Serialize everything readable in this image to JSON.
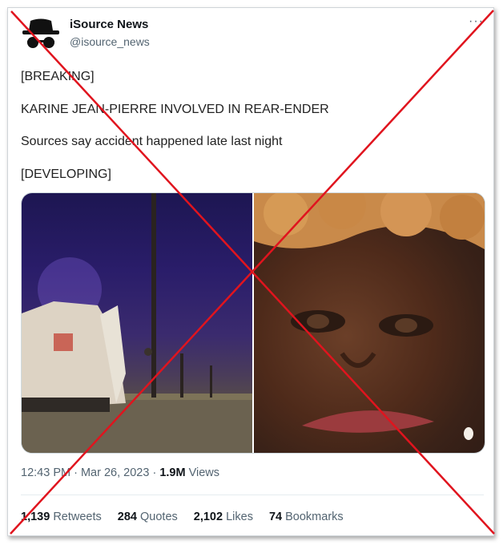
{
  "tweet": {
    "author_name": "iSource News",
    "author_handle": "@isource_news",
    "more_label": "···",
    "lines": [
      "[BREAKING]",
      "KARINE JEAN-PIERRE INVOLVED IN REAR-ENDER",
      "Sources say accident happened late last night",
      "[DEVELOPING]"
    ],
    "time": "12:43 PM",
    "date": "Mar 26, 2023",
    "views_count": "1.9M",
    "views_label": "Views",
    "retweets_count": "1,139",
    "retweets_label": "Retweets",
    "quotes_count": "284",
    "quotes_label": "Quotes",
    "likes_count": "2,102",
    "likes_label": "Likes",
    "bookmarks_count": "74",
    "bookmarks_label": "Bookmarks"
  },
  "colors": {
    "cross": "#e0141e",
    "secondary_text": "#536471",
    "primary_text": "#0f1419"
  },
  "icons": {
    "avatar": "spy-hat-glasses-icon",
    "more": "more-dots-icon",
    "overlay": "red-x-cross-icon"
  }
}
